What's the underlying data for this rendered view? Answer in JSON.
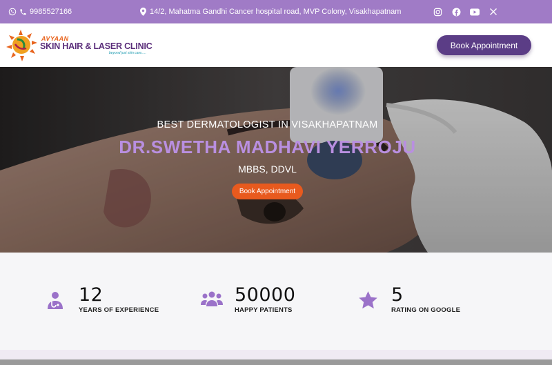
{
  "topbar": {
    "phone": "9985527166",
    "address": "14/2, Mahatma Gandhi Cancer hospital road, MVP Colony, Visakhapatnam",
    "socials": [
      "instagram-icon",
      "facebook-icon",
      "youtube-icon",
      "x-icon"
    ]
  },
  "header": {
    "logo_top": "AVYAAN",
    "logo_main": "SKIN HAIR & LASER CLINIC",
    "logo_tagline": "beyond just skin care.....",
    "book_label": "Book Appointment"
  },
  "hero": {
    "eyebrow": "BEST DERMATOLOGIST IN VISAKHAPATNAM",
    "name": "DR.SWETHA MADHAVI YERROJU",
    "degree": "MBBS, DDVL",
    "cta_label": "Book Appointment"
  },
  "stats": [
    {
      "number": "12",
      "label": "YEARS OF EXPERIENCE",
      "icon": "doctor-icon"
    },
    {
      "number": "50000",
      "label": "HAPPY PATIENTS",
      "icon": "users-icon"
    },
    {
      "number": "5",
      "label": "RATING ON GOOGLE",
      "icon": "star-icon"
    }
  ],
  "colors": {
    "topbar": "#a07bc6",
    "brand_purple": "#5b3d86",
    "accent_orange": "#e85a1e",
    "name_lavender": "#b98fe0",
    "icon_purple": "#9b72c9"
  }
}
